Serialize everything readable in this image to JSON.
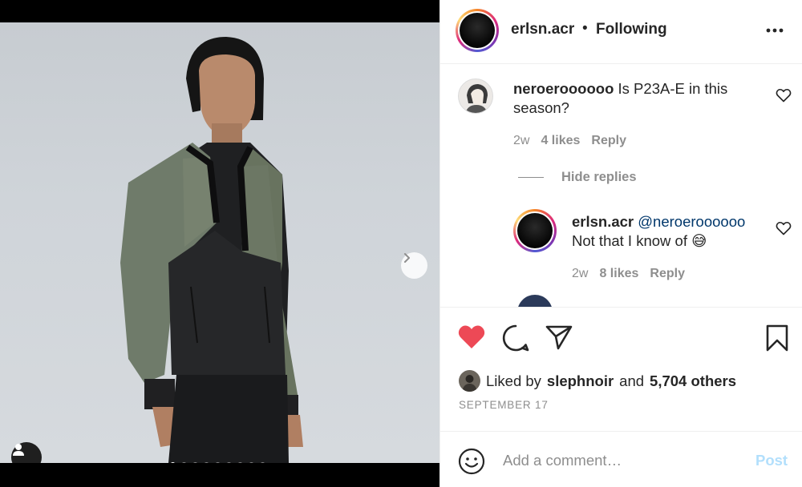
{
  "post": {
    "carousel": {
      "slide_count": 9,
      "active_index": 0,
      "next_icon": "chevron-right-icon",
      "tag_icon": "user-tag-icon"
    }
  },
  "header": {
    "username": "erlsn.acr",
    "separator": "•",
    "follow_status": "Following",
    "more_icon": "more-horizontal-icon"
  },
  "comments": [
    {
      "username": "neroeroooooo",
      "text": "Is P23A-E in this season?",
      "time": "2w",
      "likes": "4 likes",
      "reply_label": "Reply",
      "hide_replies_label": "Hide replies",
      "replies": [
        {
          "username": "erlsn.acr",
          "mention": "@neroeroooooo",
          "text": "Not that I know of 😅",
          "time": "2w",
          "likes": "8 likes",
          "reply_label": "Reply"
        }
      ]
    }
  ],
  "actions": {
    "liked": true,
    "like_color": "#ed4956",
    "icons": [
      "heart-icon",
      "comment-icon",
      "share-icon",
      "bookmark-icon"
    ]
  },
  "likes_summary": {
    "prefix": "Liked by",
    "user": "slephnoir",
    "conjunction": "and",
    "others": "5,704 others"
  },
  "date": "SEPTEMBER 17",
  "add_comment": {
    "placeholder": "Add a comment…",
    "post_label": "Post",
    "post_color": "#b2dffc",
    "emoji_icon": "smiley-icon"
  }
}
